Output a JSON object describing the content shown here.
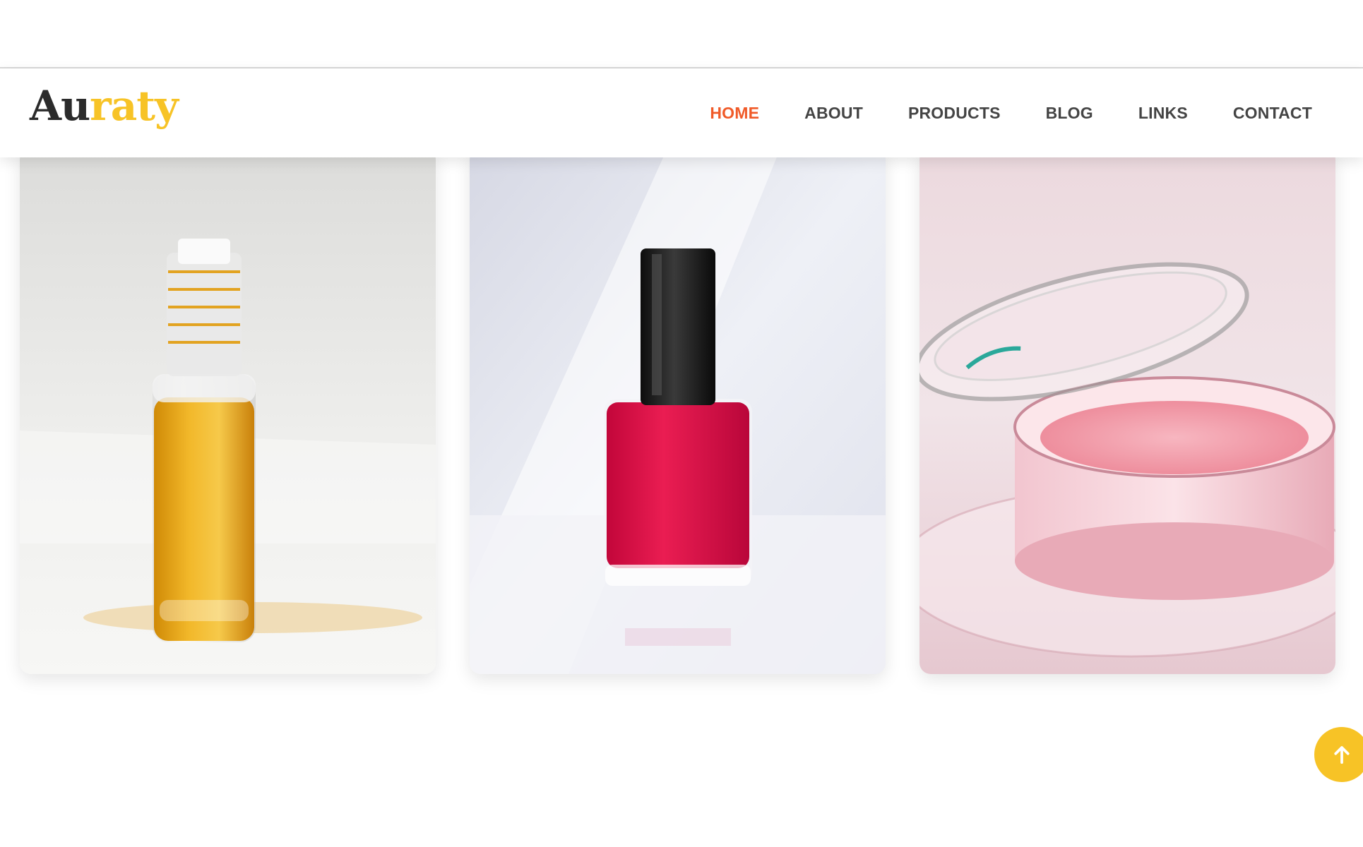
{
  "brand": {
    "part1": "Au",
    "part2": "raty"
  },
  "colors": {
    "accent": "#f05a28",
    "gold": "#f7c326",
    "text": "#444444"
  },
  "nav": {
    "items": [
      {
        "label": "HOME",
        "active": true
      },
      {
        "label": "ABOUT"
      },
      {
        "label": "PRODUCTS"
      },
      {
        "label": "BLOG"
      },
      {
        "label": "LINKS"
      },
      {
        "label": "CONTACT"
      }
    ]
  },
  "products": [
    {
      "image": "serum-oil-bottle"
    },
    {
      "image": "red-nail-polish"
    },
    {
      "image": "pink-blush-compact"
    }
  ],
  "scroll_top": {
    "icon": "arrow-up-icon"
  }
}
